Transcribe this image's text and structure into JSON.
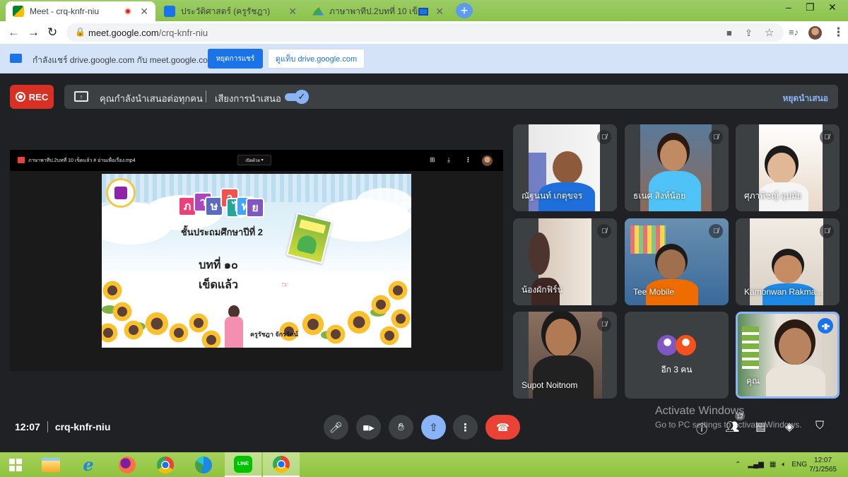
{
  "browser": {
    "tabs": [
      {
        "title": "Meet - crq-knfr-niu",
        "active": true
      },
      {
        "title": "ประวัติศาสตร์ (ครูรัชฎา)",
        "active": false
      },
      {
        "title": "ภาษาพาทีป.2บทที่ 10 เข็ดแล้ว #",
        "active": false
      }
    ],
    "url_host": "meet.google.com",
    "url_path": "/crq-knfr-niu",
    "window_controls": [
      "–",
      "❐",
      "✕"
    ]
  },
  "share_bar": {
    "message": "กำลังแชร์ drive.google.com กับ meet.google.com",
    "stop_label": "หยุดการแชร์",
    "switch_label": "ดูแท็บ drive.google.com"
  },
  "meet": {
    "rec_label": "REC",
    "presenting_text": "คุณกำลังนำเสนอต่อทุกคน",
    "audio_label": "เสียงการนำเสนอ",
    "audio_on": true,
    "stop_presenting_label": "หยุดนำเสนอ",
    "time": "12:07",
    "meeting_code": "crq-knfr-niu",
    "people_count": "12"
  },
  "presentation": {
    "file_name": "ภาษาพาทีป.2บทที่ 10 เข็ดแล้ว # อ่านเพื่อเรื่อง.mp4",
    "open_with": "เปิดด้วย",
    "slide": {
      "title_blocks": [
        "ภ",
        "า",
        "ษ",
        "า",
        "ไ",
        "ท",
        "ย"
      ],
      "grade": "ชั้นประถมศึกษาปีที่ 2",
      "lesson_no": "บทที่ ๑๐",
      "lesson_name": "เข็ดแล้ว",
      "author": "ครูรัชฎา จักรรัตน์"
    }
  },
  "participants": [
    {
      "name": "ณัฐนนท์ เกตุขจร",
      "muted": true
    },
    {
      "name": "ธเนศ สิงห์น้อย",
      "muted": true
    },
    {
      "name": "ศุภาพิชญ์ อุปมัย",
      "muted": true
    },
    {
      "name": "น้องผักฟิร์น",
      "muted": true
    },
    {
      "name": "Tee Mobile",
      "muted": true
    },
    {
      "name": "Kamonwan Rakma...",
      "muted": true
    },
    {
      "name": "Supot Noitnom",
      "muted": true
    },
    {
      "name": "อีก 3 คน",
      "muted": false
    },
    {
      "name": "คุณ",
      "muted": false,
      "speaking": true
    }
  ],
  "watermark": {
    "line1": "Activate Windows",
    "line2": "Go to PC settings to activate Windows."
  },
  "taskbar": {
    "lang": "ENG",
    "time": "12:07",
    "date": "7/1/2565",
    "line_label": "LINE"
  }
}
